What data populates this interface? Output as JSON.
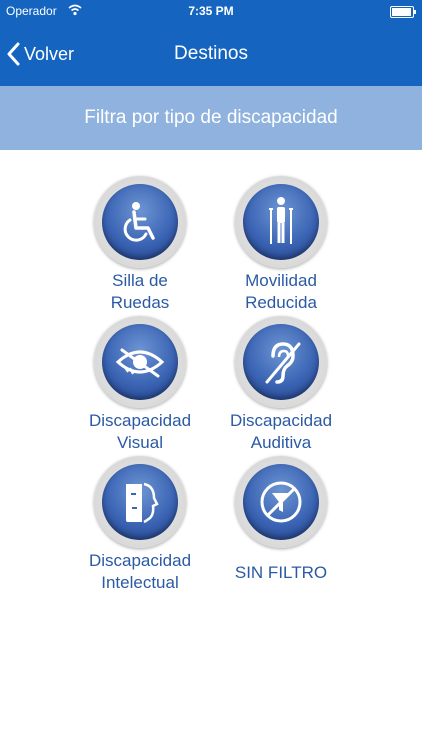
{
  "status": {
    "carrier": "Operador",
    "time": "7:35 PM"
  },
  "nav": {
    "back_label": "Volver",
    "title": "Destinos"
  },
  "filter": {
    "title": "Filtra por tipo de discapacidad"
  },
  "options": [
    {
      "line1": "Silla de",
      "line2": "Ruedas",
      "icon": "wheelchair-icon"
    },
    {
      "line1": "Movilidad",
      "line2": "Reducida",
      "icon": "crutches-person-icon"
    },
    {
      "line1": "Discapacidad",
      "line2": "Visual",
      "icon": "eye-slash-icon"
    },
    {
      "line1": "Discapacidad",
      "line2": "Auditiva",
      "icon": "ear-slash-icon"
    },
    {
      "line1": "Discapacidad",
      "line2": "Intelectual",
      "icon": "face-profile-icon"
    },
    {
      "line1": "SIN FILTRO",
      "line2": "",
      "icon": "no-filter-icon"
    }
  ],
  "colors": {
    "navbar": "#1565c0",
    "filterbar": "#8fb3de",
    "label": "#2b5aa5"
  }
}
